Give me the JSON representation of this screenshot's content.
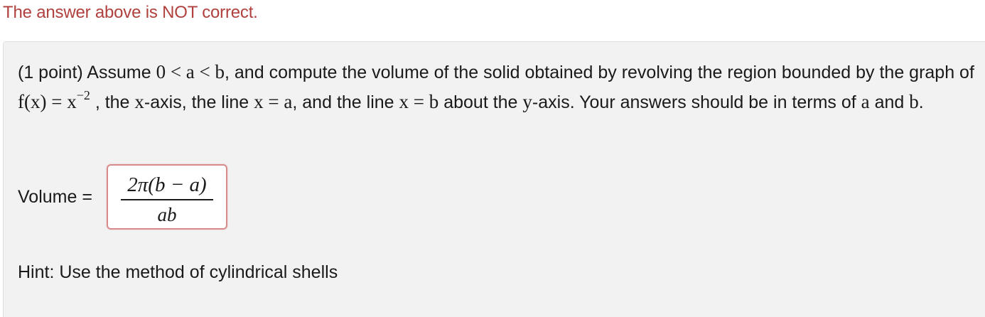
{
  "status": {
    "message": "The answer above is NOT correct.",
    "color": "#b0413e"
  },
  "problem": {
    "points": "(1 point)",
    "t1": "Assume",
    "ineq": "0 < a < b",
    "t2": ", and compute the volume of the solid obtained by revolving the region bounded by the graph of",
    "fx": "f(x) = x",
    "exp": "−2",
    "t3": ", the",
    "xaxis": "x",
    "t4": "-axis, the line",
    "xa": "x = a",
    "t5": ", and the line",
    "xb": "x = b",
    "t6": "about the",
    "yaxis": "y",
    "t7": "-axis. Your answers should be in terms of",
    "va": "a",
    "t8": "and",
    "vb": "b",
    "t9": "."
  },
  "answer": {
    "label": "Volume =",
    "numerator": "2π(b − a)",
    "denominator": "ab",
    "state": "incorrect"
  },
  "hint": {
    "text": "Hint: Use the method of cylindrical shells"
  }
}
